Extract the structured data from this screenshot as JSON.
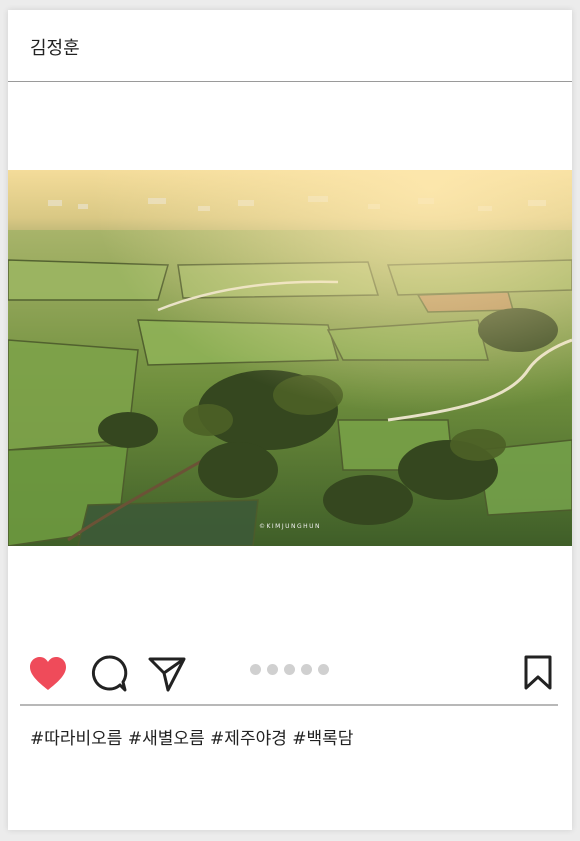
{
  "post": {
    "username": "김정훈",
    "photo_caption_watermark": "©KIMJUNGHUN",
    "hashtags": "#따라비오름 #새별오름 #제주야경 #백록담"
  },
  "carousel": {
    "total": 5,
    "active_index": 0
  },
  "icons": {
    "like": "heart-icon",
    "comment": "speech-bubble-icon",
    "share": "paper-plane-icon",
    "save": "bookmark-icon"
  },
  "colors": {
    "like_active": "#ef4b5a",
    "icon_stroke": "#222222",
    "dot_inactive": "#d0d0d0"
  }
}
